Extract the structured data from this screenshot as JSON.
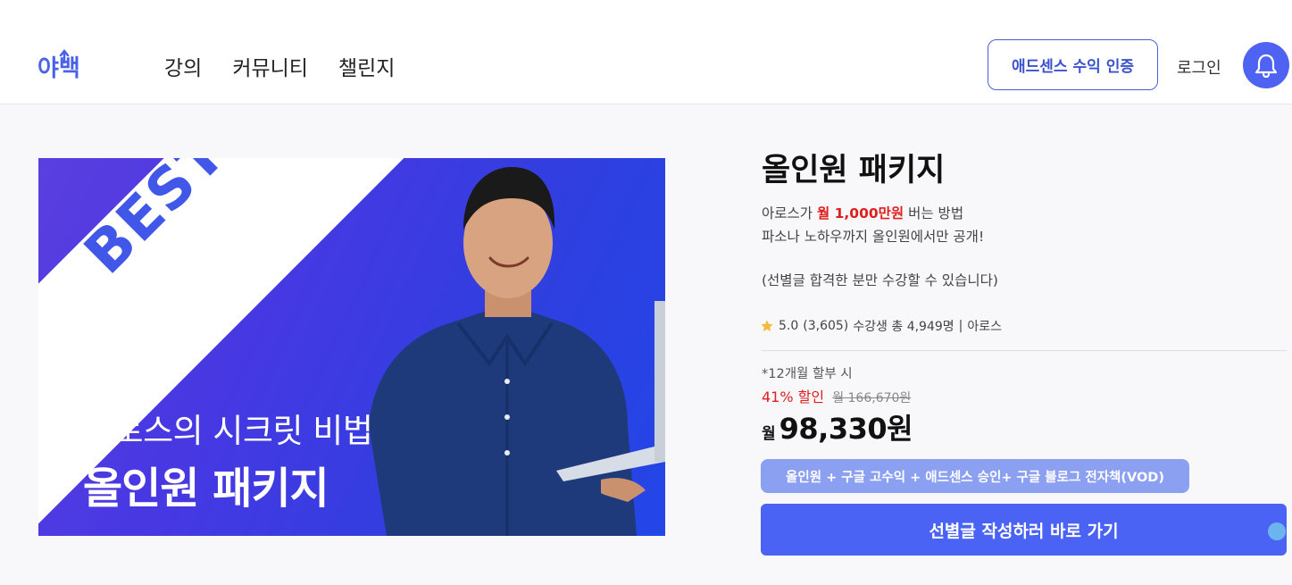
{
  "header": {
    "logo_text": "야백",
    "nav": [
      {
        "label": "강의"
      },
      {
        "label": "커뮤니티"
      },
      {
        "label": "챌린지"
      }
    ],
    "cert_button": "애드센스 수익 인증",
    "login": "로그인",
    "bell_icon": "bell-icon"
  },
  "banner": {
    "badge": "BEST",
    "subtitle": "아로스의 시크릿 비법",
    "title": "올인원 패키지"
  },
  "product": {
    "title": "올인원 패키지",
    "desc_prefix": "아로스가 ",
    "desc_highlight": "월 1,000만원",
    "desc_suffix": " 버는 방법",
    "desc_line2": "파소나 노하우까지 올인원에서만 공개!",
    "note": "(선별글 합격한 분만 수강할 수 있습니다)",
    "rating": "5.0",
    "rating_count": "(3,605)",
    "students": "수강생 총 4,949명",
    "separator": "|",
    "author": "아로스",
    "installment": "*12개월 할부 시",
    "discount_pct": "41% 할인",
    "original_price": "월 166,670원",
    "price_unit": "월",
    "price": "98,330원",
    "tag": "올인원 + 구글 고수익 + 애드센스 승인+ 구글 블로그 전자책(VOD)",
    "cta": "선별글 작성하러 바로 가기"
  },
  "colors": {
    "accent": "#4a63f5",
    "highlight_red": "#e01e1e",
    "tag_bg": "#8ca0f2"
  }
}
